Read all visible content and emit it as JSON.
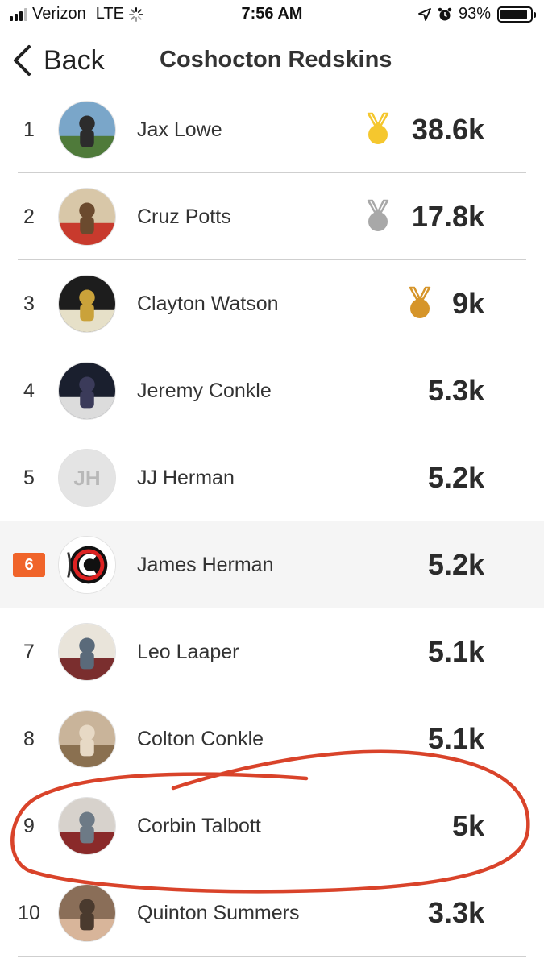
{
  "status_bar": {
    "carrier": "Verizon",
    "network": "LTE",
    "time": "7:56 AM",
    "battery_text": "93%",
    "battery_level": 0.93
  },
  "nav": {
    "back_label": "Back",
    "title": "Coshocton Redskins"
  },
  "colors": {
    "accent": "#f0642a",
    "gold": "#f5c72e",
    "silver": "#a8a8a8",
    "bronze": "#d6952a",
    "annotation": "#d9432a"
  },
  "rows": [
    {
      "rank": "1",
      "name": "Jax Lowe",
      "score": "38.6k",
      "medal": "gold",
      "avatar": "photo"
    },
    {
      "rank": "2",
      "name": "Cruz Potts",
      "score": "17.8k",
      "medal": "silver",
      "avatar": "photo"
    },
    {
      "rank": "3",
      "name": "Clayton Watson",
      "score": "9k",
      "medal": "bronze",
      "avatar": "photo"
    },
    {
      "rank": "4",
      "name": "Jeremy Conkle",
      "score": "5.3k",
      "avatar": "photo"
    },
    {
      "rank": "5",
      "name": "JJ Herman",
      "score": "5.2k",
      "avatar": "initials",
      "initials": "JH"
    },
    {
      "rank": "6",
      "name": "James Herman",
      "score": "5.2k",
      "avatar": "team-logo",
      "highlighted": true
    },
    {
      "rank": "7",
      "name": "Leo Laaper",
      "score": "5.1k",
      "avatar": "photo"
    },
    {
      "rank": "8",
      "name": "Colton Conkle",
      "score": "5.1k",
      "avatar": "photo"
    },
    {
      "rank": "9",
      "name": "Corbin Talbott",
      "score": "5k",
      "avatar": "photo",
      "circled": true
    },
    {
      "rank": "10",
      "name": "Quinton Summers",
      "score": "3.3k",
      "avatar": "photo"
    }
  ]
}
